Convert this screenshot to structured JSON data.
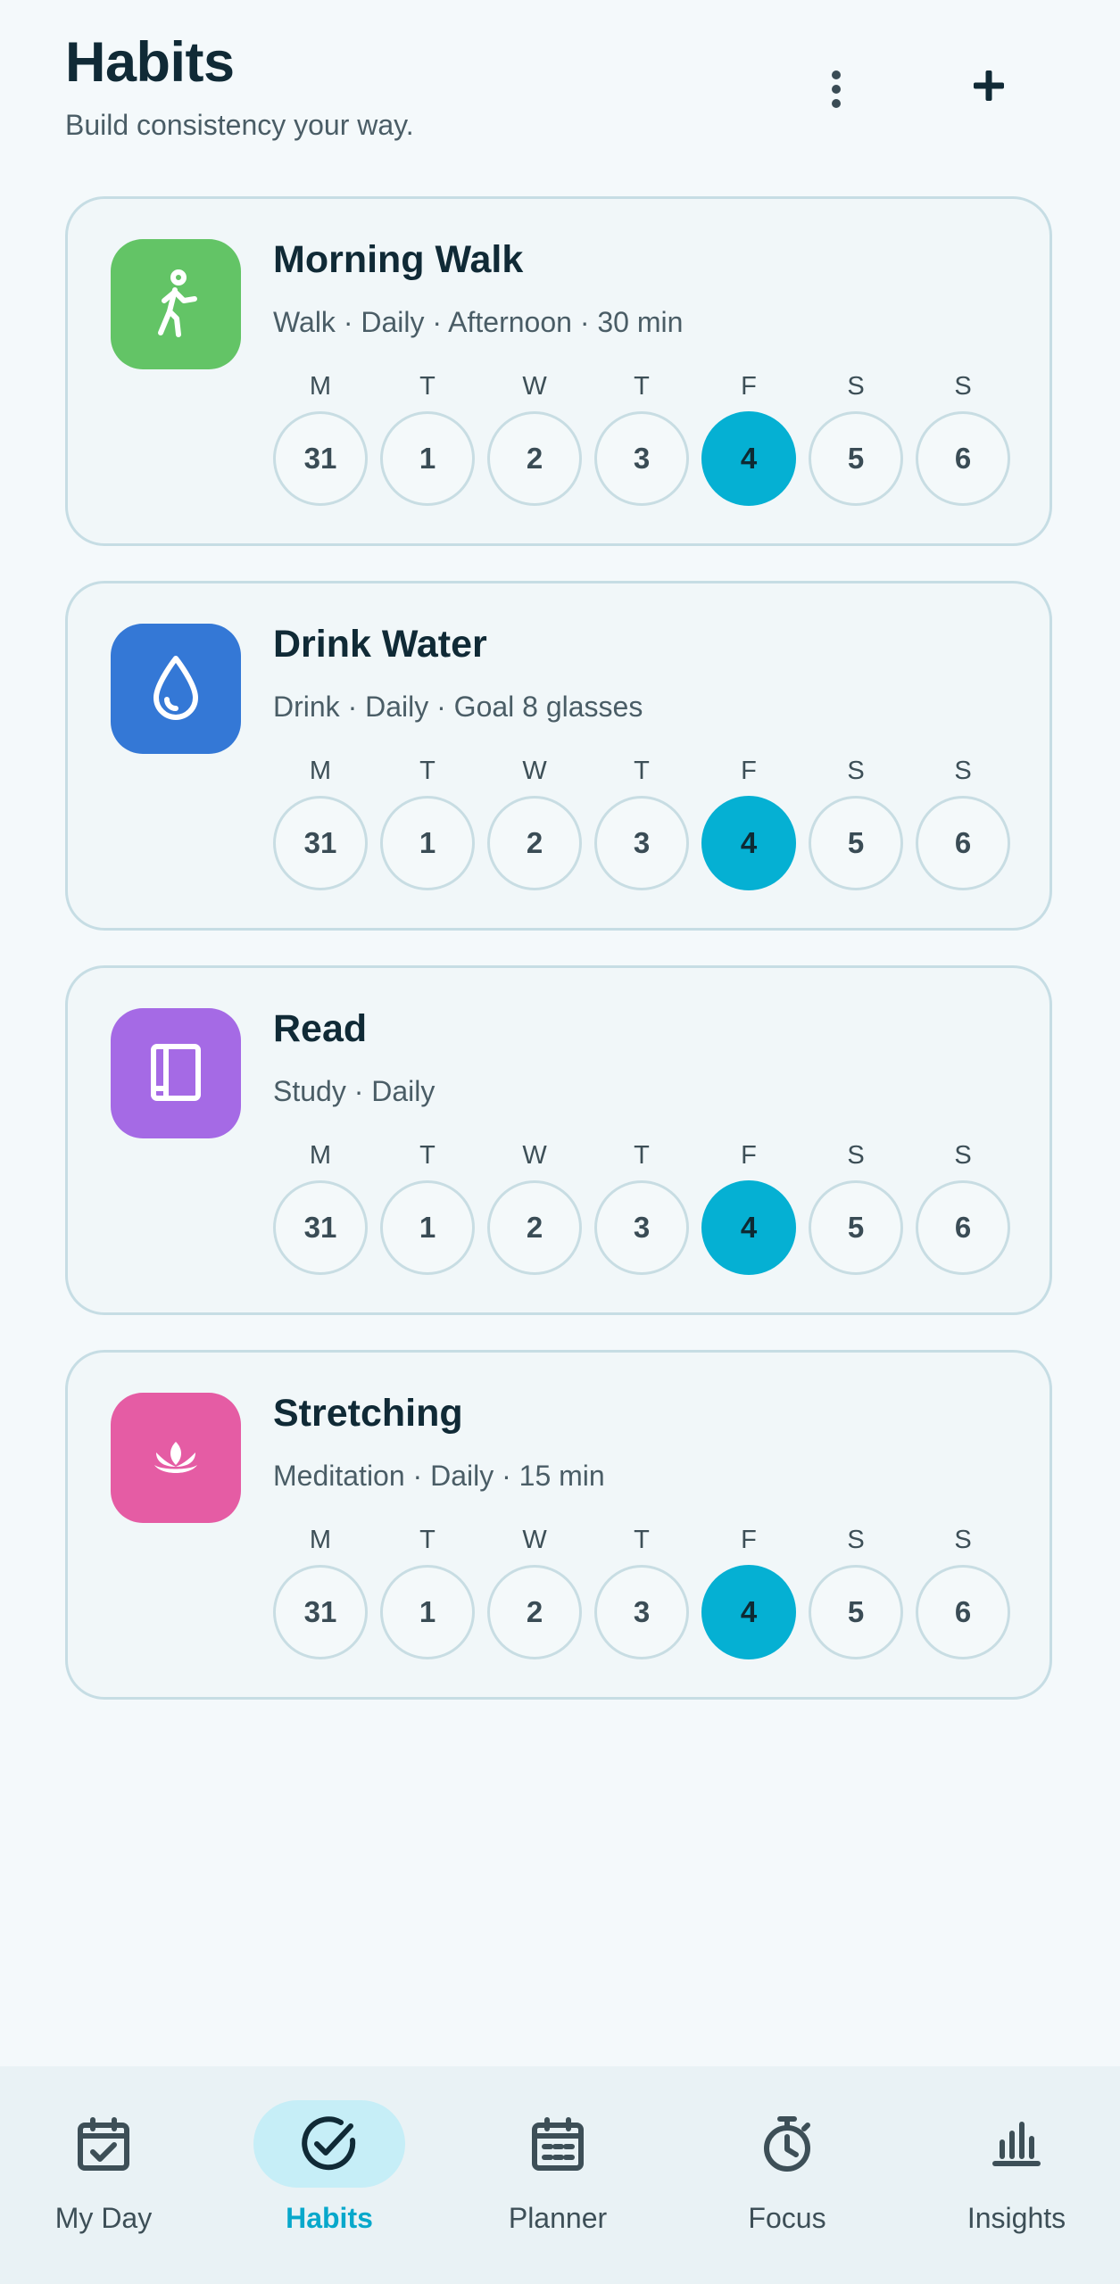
{
  "header": {
    "title": "Habits",
    "subtitle": "Build consistency your way.",
    "menu_icon": "more-vertical-icon",
    "add_icon": "plus-icon"
  },
  "weekday_letters": [
    "M",
    "T",
    "W",
    "T",
    "F",
    "S",
    "S"
  ],
  "week_dates": [
    "31",
    "1",
    "2",
    "3",
    "4",
    "5",
    "6"
  ],
  "selected_date": "4",
  "colors": {
    "accent": "#05b0d3",
    "walk": "#63c466",
    "water": "#3478d6",
    "read": "#a56ae5",
    "stretch": "#e55ca4"
  },
  "habits": [
    {
      "name": "Morning Walk",
      "meta": "Walk · Daily · Afternoon · 30 min",
      "icon": "walking-person-icon",
      "color": "#63c466"
    },
    {
      "name": "Drink Water",
      "meta": "Drink · Daily · Goal 8 glasses",
      "icon": "water-drop-icon",
      "color": "#3478d6"
    },
    {
      "name": "Read",
      "meta": "Study · Daily",
      "icon": "book-icon",
      "color": "#a56ae5"
    },
    {
      "name": "Stretching",
      "meta": "Meditation · Daily · 15 min",
      "icon": "lotus-icon",
      "color": "#e55ca4"
    }
  ],
  "nav": [
    {
      "label": "My Day",
      "icon": "calendar-check-icon",
      "active": false
    },
    {
      "label": "Habits",
      "icon": "check-circle-icon",
      "active": true
    },
    {
      "label": "Planner",
      "icon": "calendar-grid-icon",
      "active": false
    },
    {
      "label": "Focus",
      "icon": "stopwatch-icon",
      "active": false
    },
    {
      "label": "Insights",
      "icon": "bar-chart-icon",
      "active": false
    }
  ]
}
